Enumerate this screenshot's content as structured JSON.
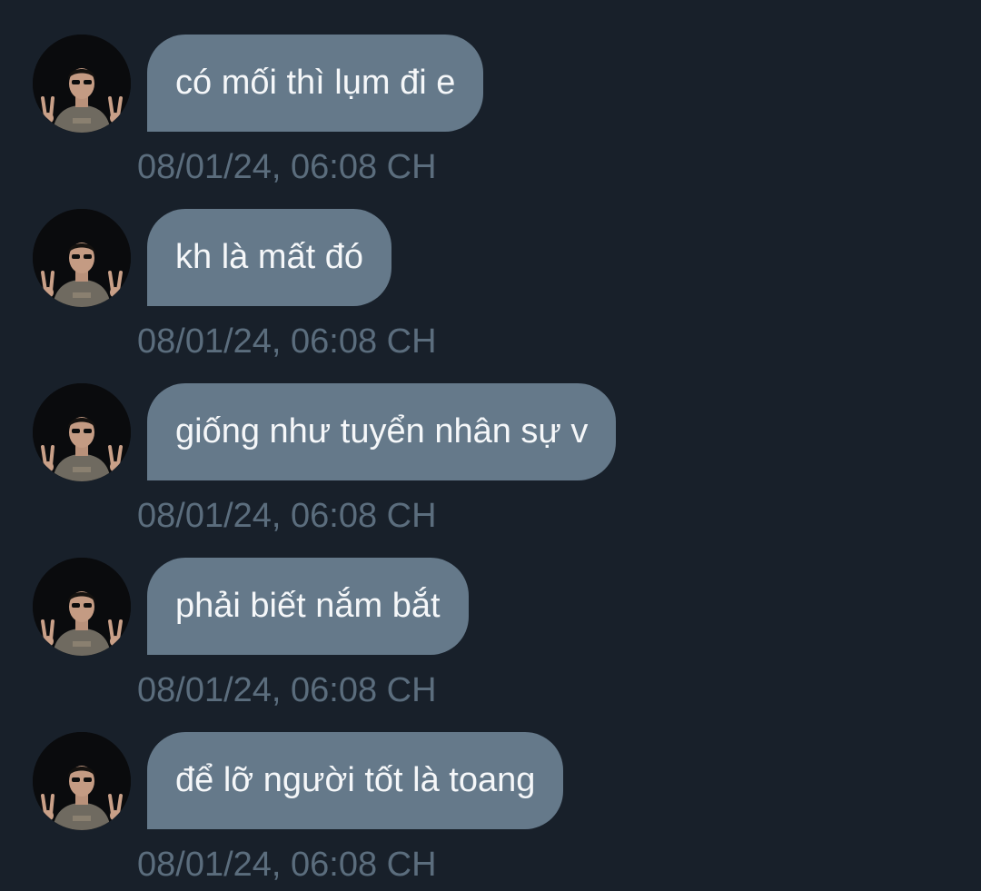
{
  "messages": [
    {
      "text": "có mối thì lụm đi e",
      "time": "08/01/24, 06:08 CH"
    },
    {
      "text": "kh là mất đó",
      "time": "08/01/24, 06:08 CH"
    },
    {
      "text": "giống như tuyển nhân sự v",
      "time": "08/01/24, 06:08 CH"
    },
    {
      "text": "phải biết nắm bắt",
      "time": "08/01/24, 06:08 CH"
    },
    {
      "text": "để lỡ người tốt là toang",
      "time": "08/01/24, 06:08 CH"
    }
  ],
  "colors": {
    "background": "#18202a",
    "bubble": "#65798a",
    "bubble_text": "#f5f7f9",
    "timestamp": "#5b6d7d"
  }
}
